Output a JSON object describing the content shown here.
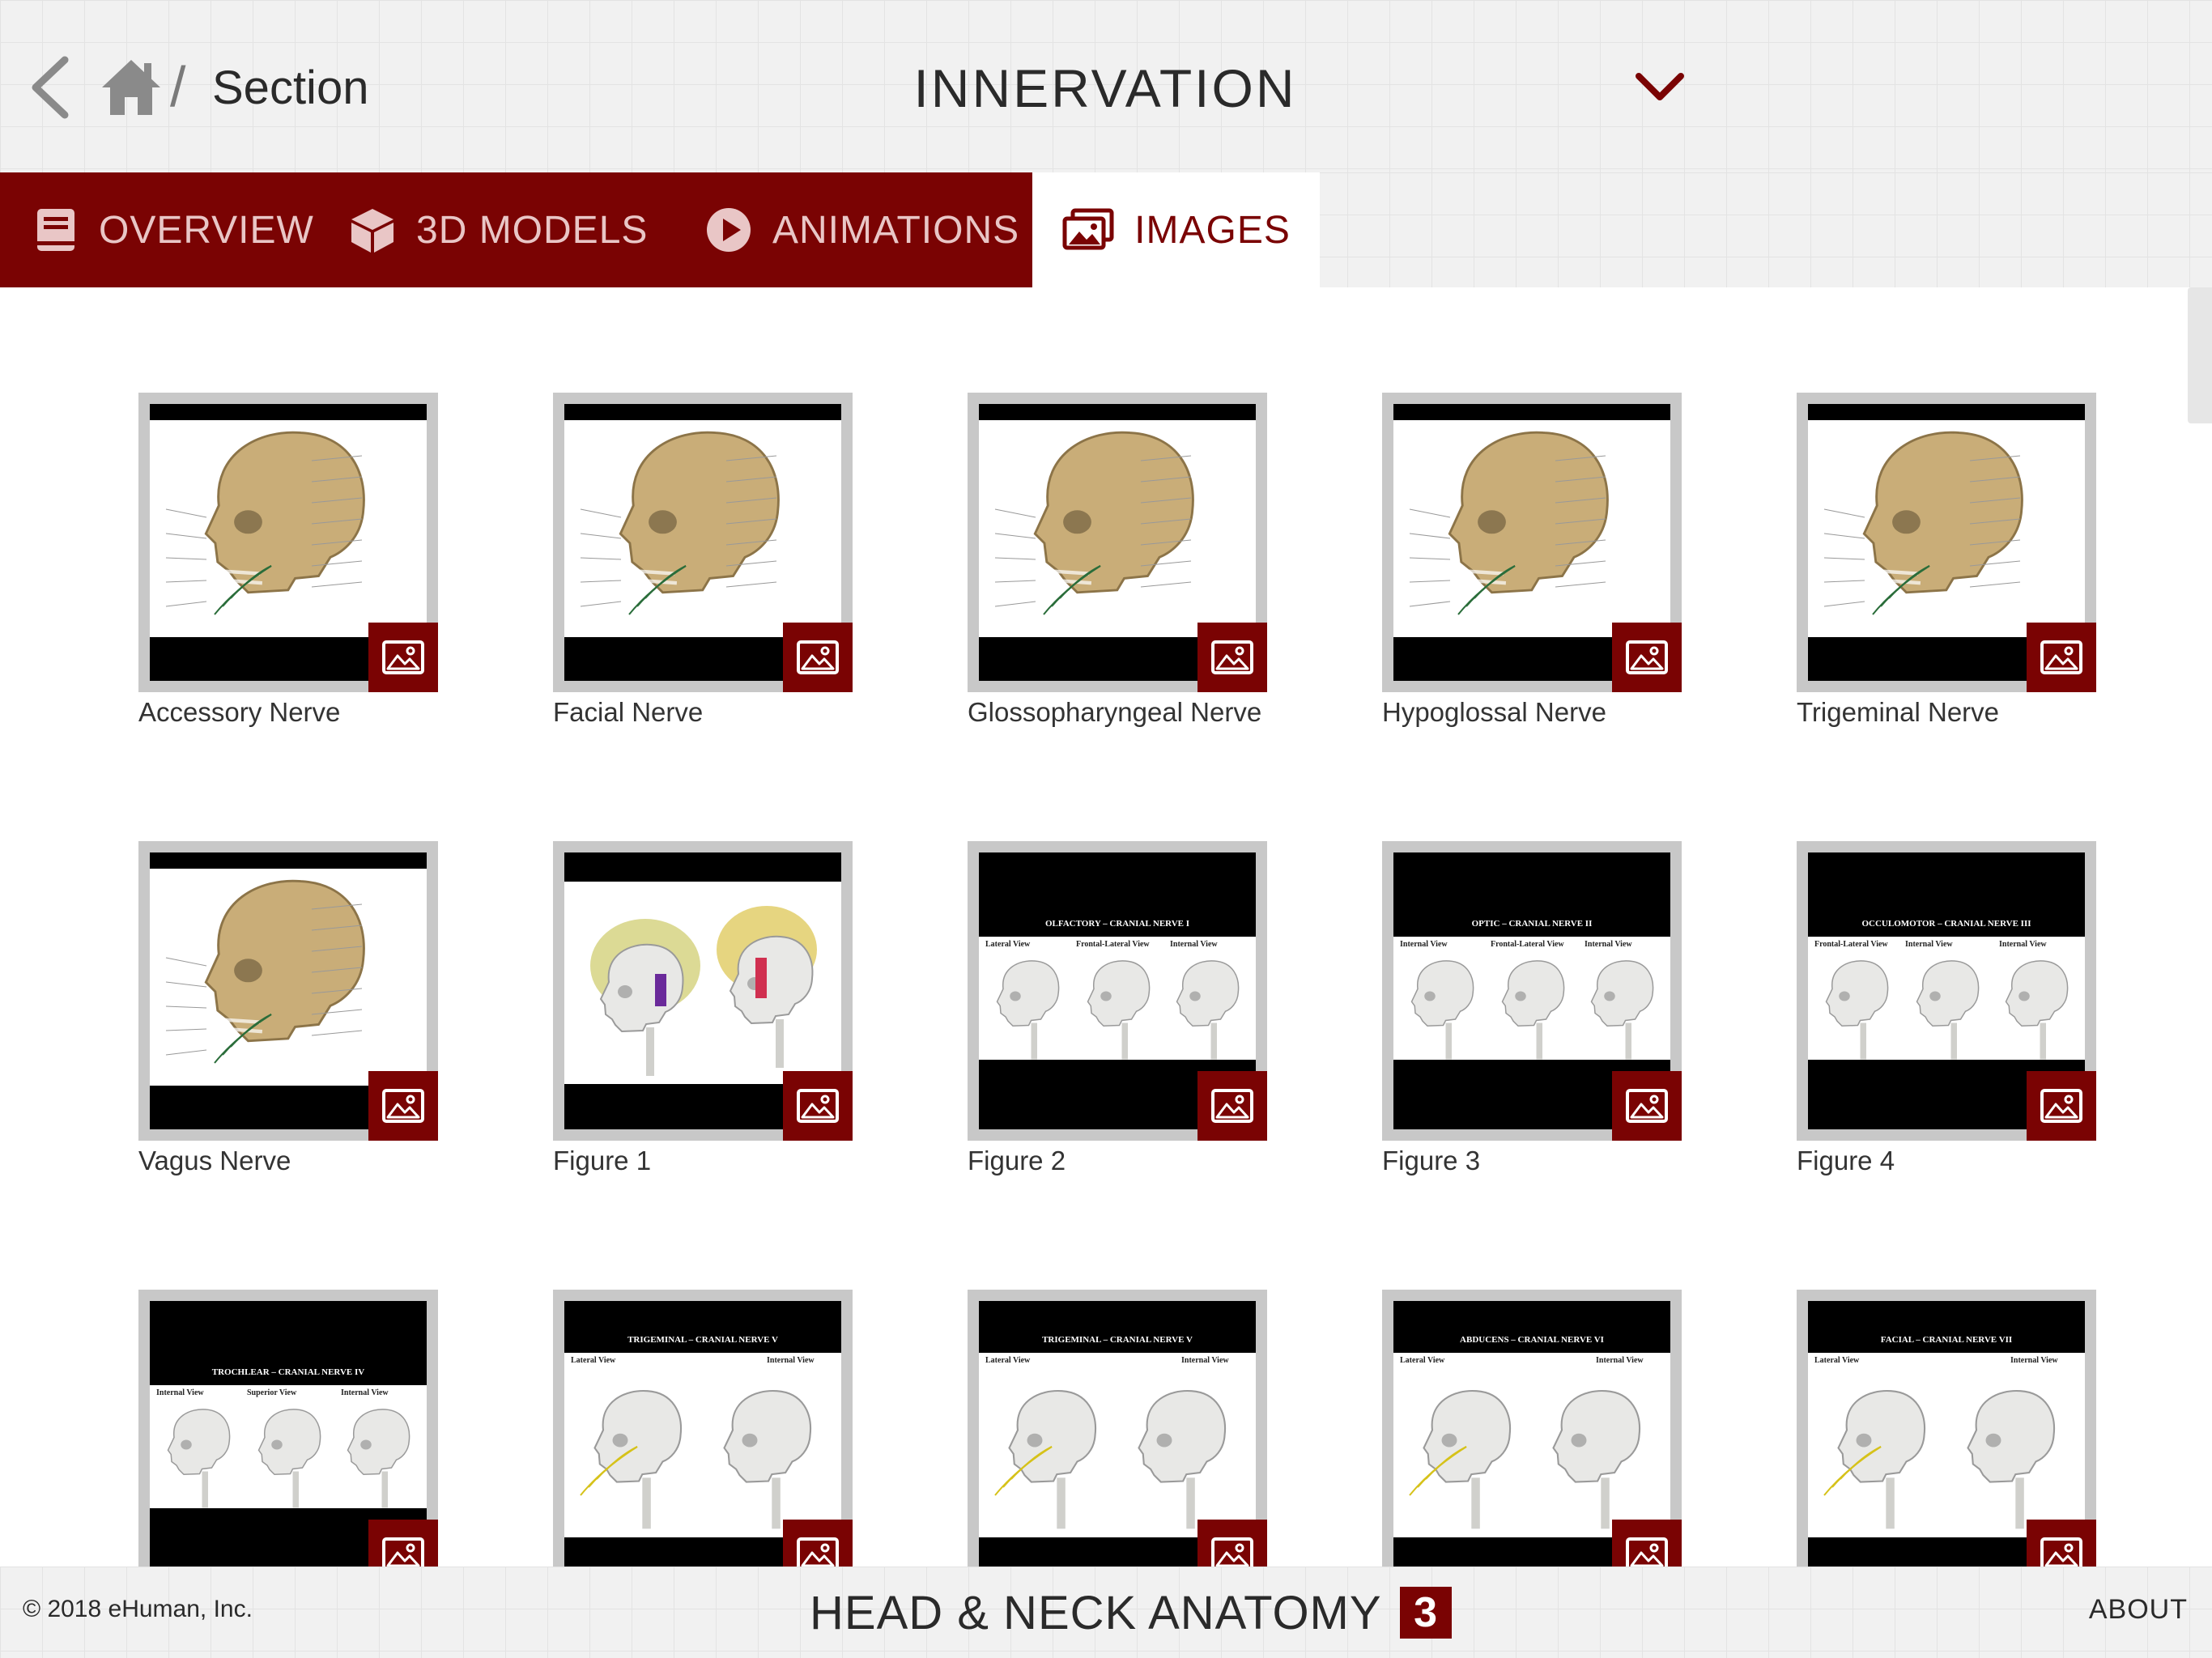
{
  "header": {
    "breadcrumb_separator": "/",
    "breadcrumb_section": "Section",
    "title": "INNERVATION",
    "back_icon": "chevron-left-icon",
    "home_icon": "home-icon",
    "dropdown_icon": "chevron-down-icon"
  },
  "tabs": [
    {
      "label": "OVERVIEW",
      "icon": "book-icon"
    },
    {
      "label": "3D MODELS",
      "icon": "cube-icon"
    },
    {
      "label": "ANIMATIONS",
      "icon": "play-icon"
    },
    {
      "label": "IMAGES",
      "icon": "images-icon",
      "active": true
    }
  ],
  "images": [
    {
      "caption": "Accessory Nerve",
      "style": "skull"
    },
    {
      "caption": "Facial Nerve",
      "style": "skull"
    },
    {
      "caption": "Glossopharyngeal Nerve",
      "style": "skull"
    },
    {
      "caption": "Hypoglossal Nerve",
      "style": "skull"
    },
    {
      "caption": "Trigeminal Nerve",
      "style": "skull"
    },
    {
      "caption": "Vagus Nerve",
      "style": "skull"
    },
    {
      "caption": "Figure 1",
      "style": "double"
    },
    {
      "caption": "Figure 2",
      "style": "triple",
      "panel_title": "OLFACTORY – CRANIAL NERVE I",
      "views": [
        "Lateral View",
        "Frontal-Lateral View",
        "Internal View"
      ]
    },
    {
      "caption": "Figure 3",
      "style": "triple",
      "panel_title": "OPTIC – CRANIAL NERVE II",
      "views": [
        "Internal View",
        "Frontal-Lateral View",
        "Internal View"
      ]
    },
    {
      "caption": "Figure 4",
      "style": "triple",
      "panel_title": "OCCULOMOTOR – CRANIAL NERVE III",
      "views": [
        "Frontal-Lateral View",
        "Internal View",
        "Internal View"
      ]
    },
    {
      "caption": "",
      "style": "triple",
      "panel_title": "TROCHLEAR – CRANIAL NERVE IV",
      "views": [
        "Internal View",
        "Superior View",
        "Internal View"
      ]
    },
    {
      "caption": "",
      "style": "pair",
      "panel_title": "TRIGEMINAL – CRANIAL NERVE V",
      "views": [
        "Lateral View",
        "Internal View"
      ]
    },
    {
      "caption": "",
      "style": "pair",
      "panel_title": "TRIGEMINAL – CRANIAL NERVE V",
      "views": [
        "Lateral View",
        "Internal View"
      ]
    },
    {
      "caption": "",
      "style": "pair",
      "panel_title": "ABDUCENS – CRANIAL NERVE VI",
      "views": [
        "Lateral View",
        "Internal View"
      ]
    },
    {
      "caption": "",
      "style": "pair",
      "panel_title": "FACIAL – CRANIAL NERVE VII",
      "views": [
        "Lateral View",
        "Internal View"
      ]
    }
  ],
  "badge_icon": "image-icon",
  "footer": {
    "copyright": "© 2018 eHuman, Inc.",
    "brand": "HEAD & NECK ANATOMY",
    "brand_number": "3",
    "about": "ABOUT"
  },
  "colors": {
    "accent": "#7a0303",
    "tab_text": "#e9c6c6",
    "background_grid": "#f1f1f1"
  }
}
